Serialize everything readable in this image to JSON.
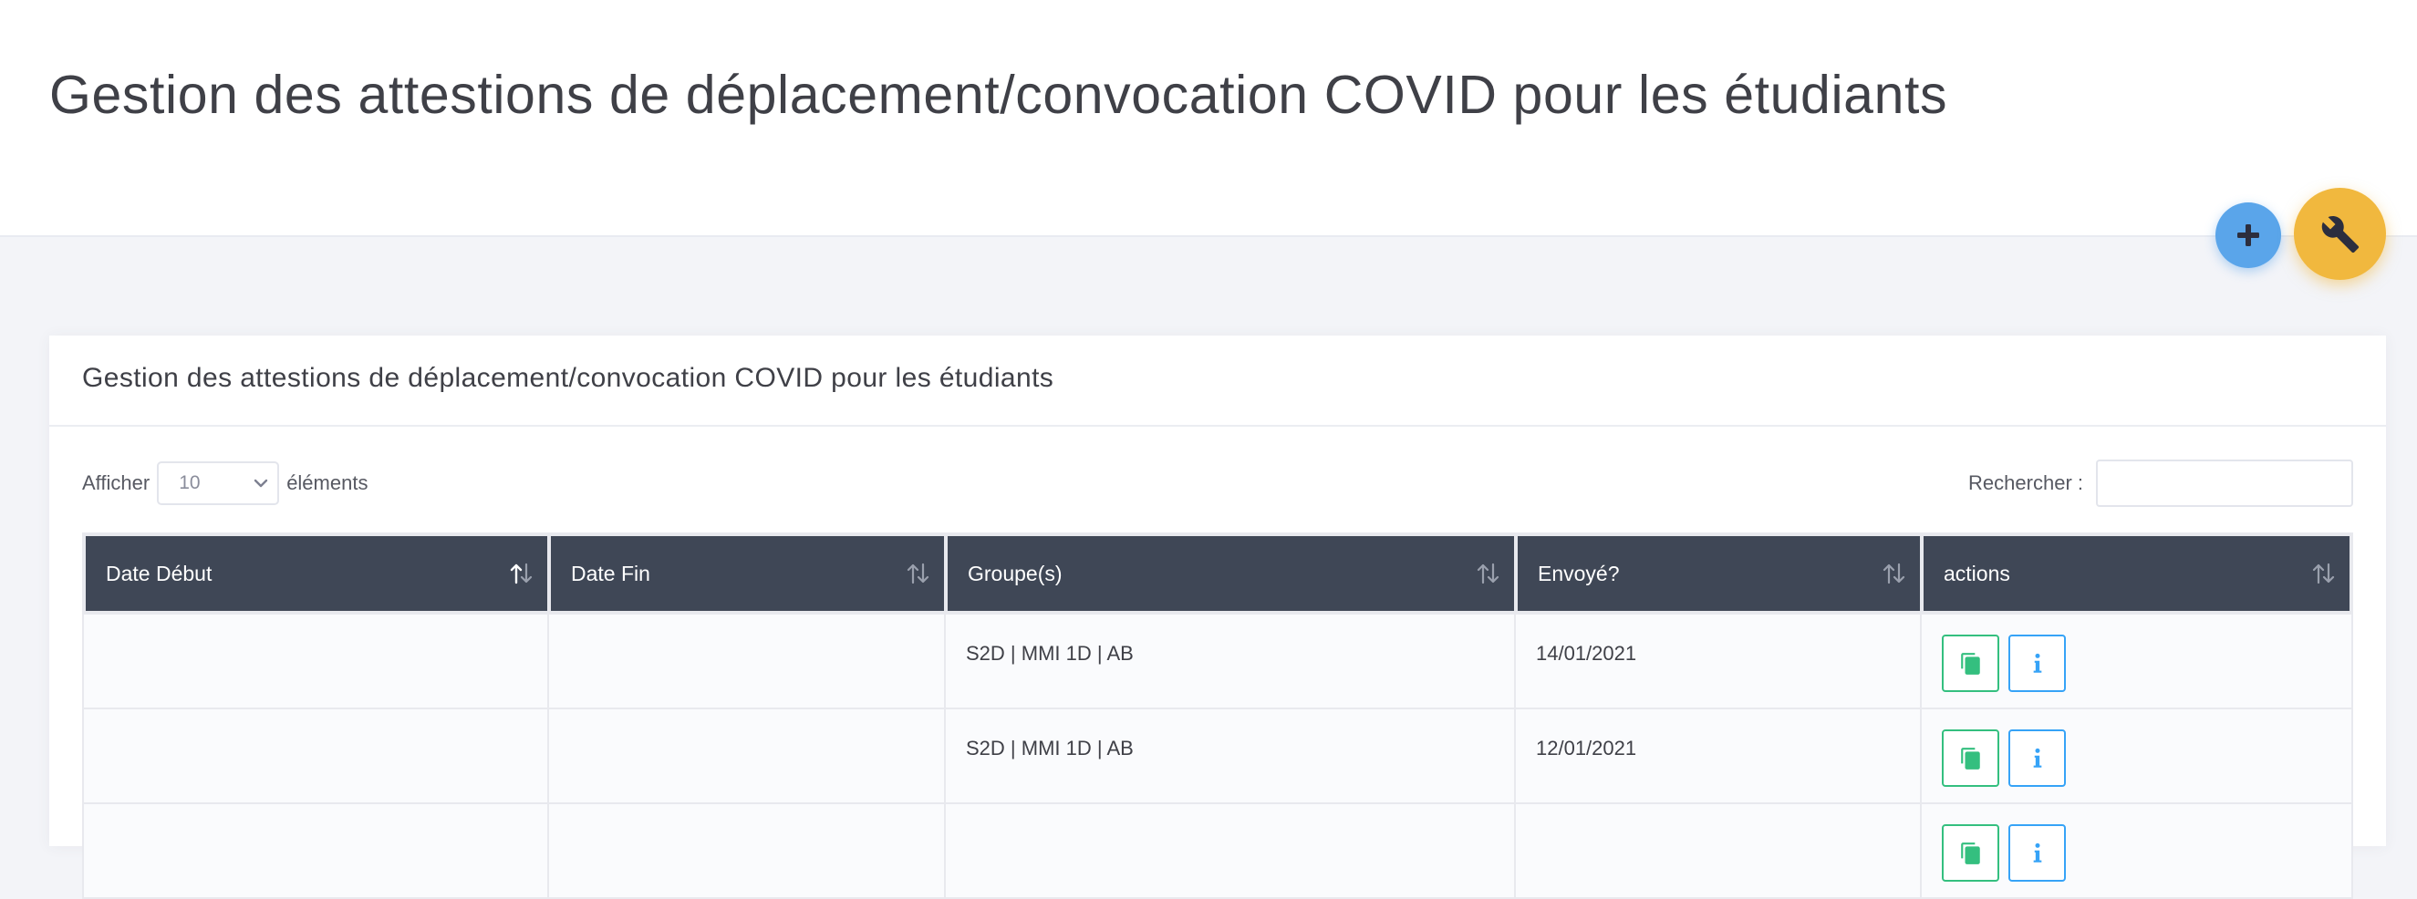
{
  "page": {
    "title": "Gestion des attestions de déplacement/convocation COVID pour les étudiants"
  },
  "fab": {
    "add_icon": "plus-icon",
    "tools_icon": "wrench-icon",
    "add_color": "#5aa5ea",
    "tools_color": "#f1b83e"
  },
  "portlet": {
    "title": "Gestion des attestions de déplacement/convocation COVID pour les étudiants"
  },
  "table_controls": {
    "show_label": "Afficher",
    "page_length": "10",
    "elements_label": "éléments",
    "search_label": "Rechercher :",
    "search_value": ""
  },
  "table": {
    "columns": [
      "Date Début",
      "Date Fin",
      "Groupe(s)",
      "Envoyé?",
      "actions"
    ],
    "rows": [
      {
        "date_debut": "",
        "date_fin": "",
        "groupes": "S2D | MMI 1D | AB",
        "envoye": "14/01/2021"
      },
      {
        "date_debut": "",
        "date_fin": "",
        "groupes": "S2D | MMI 1D | AB",
        "envoye": "12/01/2021"
      },
      {
        "date_debut": "",
        "date_fin": "",
        "groupes": "",
        "envoye": ""
      }
    ],
    "header_color": "#3f4756",
    "action_icons": [
      "copy-icon",
      "info-icon"
    ],
    "action_colors": {
      "copy": "#34bf7f",
      "info": "#36a3f7"
    }
  }
}
